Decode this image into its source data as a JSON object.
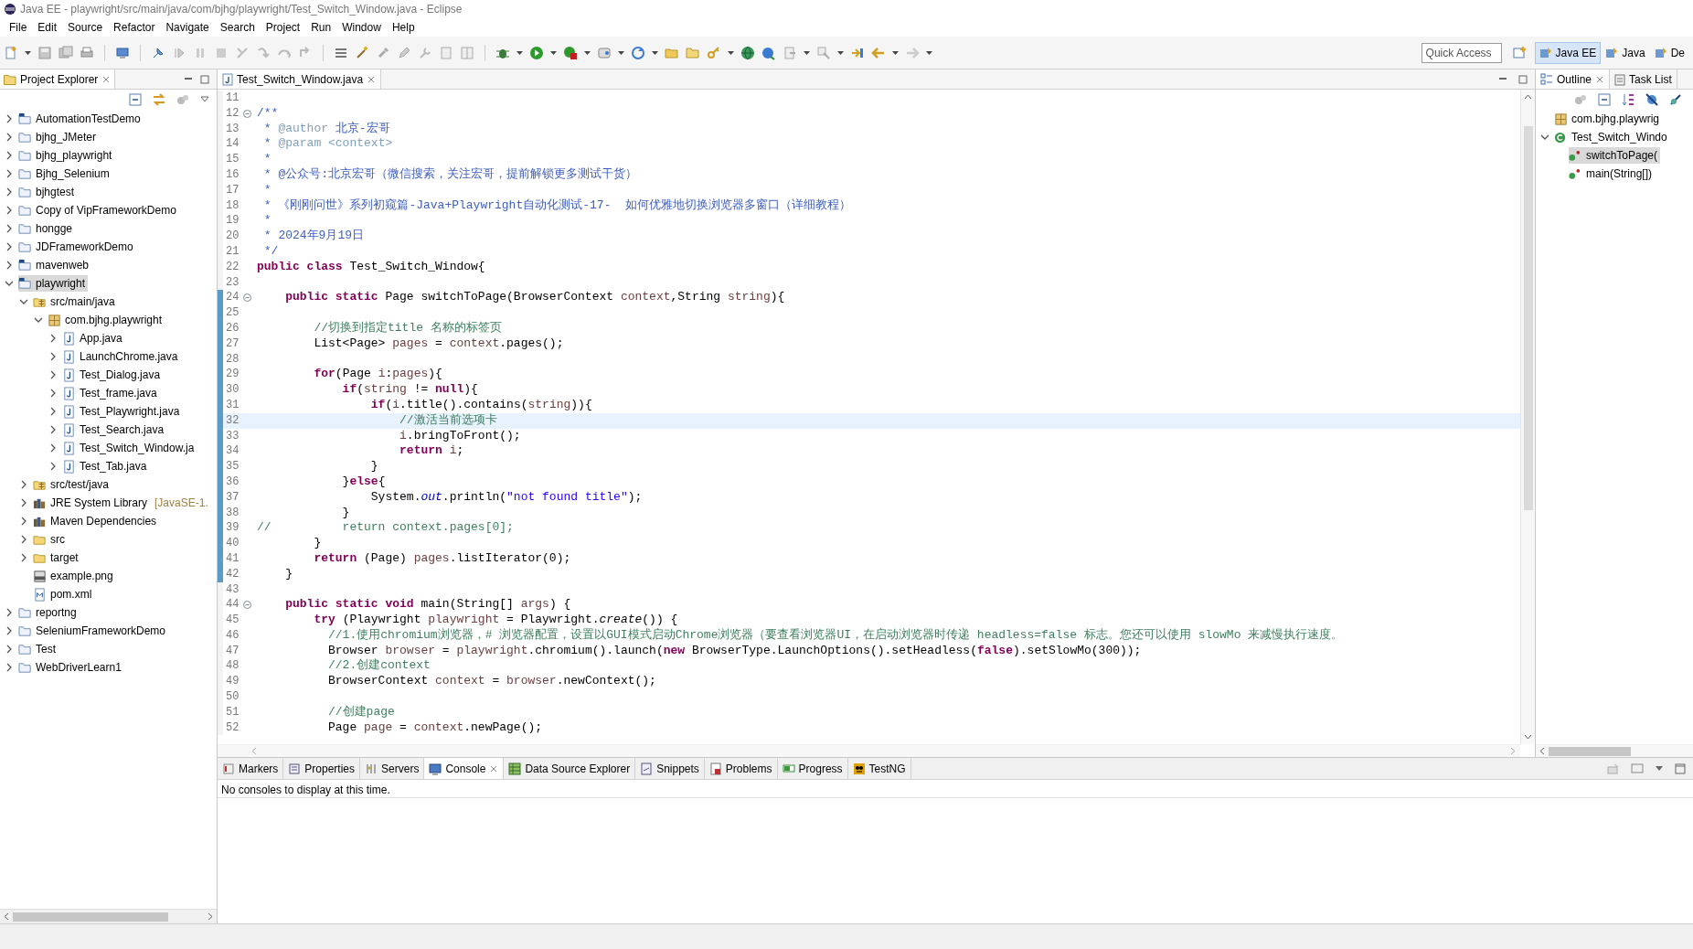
{
  "window": {
    "title": "Java EE - playwright/src/main/java/com/bjhg/playwright/Test_Switch_Window.java - Eclipse"
  },
  "menu": [
    "File",
    "Edit",
    "Source",
    "Refactor",
    "Navigate",
    "Search",
    "Project",
    "Run",
    "Window",
    "Help"
  ],
  "toolbar": {
    "quick_access": {
      "placeholder": "Quick Access"
    },
    "perspectives": [
      {
        "label": "Java EE",
        "selected": true
      },
      {
        "label": "Java",
        "selected": false
      },
      {
        "label": "De",
        "selected": false
      }
    ]
  },
  "project_explorer": {
    "title": "Project Explorer",
    "tree": [
      {
        "label": "AutomationTestDemo",
        "kind": "maven",
        "expanded": false,
        "selected": false
      },
      {
        "label": "bjhg_JMeter",
        "kind": "project",
        "expanded": false,
        "selected": false
      },
      {
        "label": "bjhg_playwright",
        "kind": "project",
        "expanded": false,
        "selected": false
      },
      {
        "label": "Bjhg_Selenium",
        "kind": "project",
        "expanded": false,
        "selected": false
      },
      {
        "label": "bjhgtest",
        "kind": "project",
        "expanded": false,
        "selected": false
      },
      {
        "label": "Copy of VipFrameworkDemo",
        "kind": "project",
        "expanded": false,
        "selected": false
      },
      {
        "label": "hongge",
        "kind": "project",
        "expanded": false,
        "selected": false
      },
      {
        "label": "JDFrameworkDemo",
        "kind": "project",
        "expanded": false,
        "selected": false
      },
      {
        "label": "mavenweb",
        "kind": "maven",
        "expanded": false,
        "selected": false
      },
      {
        "label": "playwright",
        "kind": "maven",
        "expanded": true,
        "selected": true,
        "children": [
          {
            "label": "src/main/java",
            "kind": "source",
            "expanded": true,
            "selected": false,
            "children": [
              {
                "label": "com.bjhg.playwright",
                "kind": "package",
                "expanded": true,
                "selected": false,
                "children": [
                  {
                    "label": "App.java",
                    "kind": "java",
                    "expanded": false,
                    "selected": false
                  },
                  {
                    "label": "LaunchChrome.java",
                    "kind": "java",
                    "expanded": false,
                    "selected": false
                  },
                  {
                    "label": "Test_Dialog.java",
                    "kind": "java",
                    "expanded": false,
                    "selected": false
                  },
                  {
                    "label": "Test_frame.java",
                    "kind": "java",
                    "expanded": false,
                    "selected": false
                  },
                  {
                    "label": "Test_Playwright.java",
                    "kind": "java",
                    "expanded": false,
                    "selected": false
                  },
                  {
                    "label": "Test_Search.java",
                    "kind": "java",
                    "expanded": false,
                    "selected": false
                  },
                  {
                    "label": "Test_Switch_Window.ja",
                    "kind": "java",
                    "expanded": false,
                    "selected": false
                  },
                  {
                    "label": "Test_Tab.java",
                    "kind": "java",
                    "expanded": false,
                    "selected": false
                  }
                ]
              }
            ]
          },
          {
            "label": "src/test/java",
            "kind": "source",
            "expanded": false,
            "selected": false
          },
          {
            "label": "JRE System Library",
            "decoration": "[JavaSE-1.",
            "kind": "library",
            "expanded": false,
            "selected": false
          },
          {
            "label": "Maven Dependencies",
            "kind": "library",
            "expanded": false,
            "selected": false
          },
          {
            "label": "src",
            "kind": "folder",
            "expanded": false,
            "selected": false
          },
          {
            "label": "target",
            "kind": "folder",
            "expanded": false,
            "selected": false
          },
          {
            "label": "example.png",
            "kind": "image",
            "selected": false
          },
          {
            "label": "pom.xml",
            "kind": "xml",
            "selected": false
          }
        ]
      },
      {
        "label": "reportng",
        "kind": "project",
        "expanded": false,
        "selected": false
      },
      {
        "label": "SeleniumFrameworkDemo",
        "kind": "project",
        "expanded": false,
        "selected": false
      },
      {
        "label": "Test",
        "kind": "project",
        "expanded": false,
        "selected": false
      },
      {
        "label": "WebDriverLearn1",
        "kind": "project",
        "expanded": false,
        "selected": false
      }
    ]
  },
  "editor": {
    "tabs": [
      {
        "label": "Test_Switch_Window.java",
        "selected": true
      }
    ],
    "lines": [
      {
        "number": "11",
        "fold": false,
        "changed": false,
        "current": false
      },
      {
        "number": "12",
        "fold": true,
        "changed": false,
        "current": false,
        "tokens": [
          {
            "kind": "doc",
            "text": "/**"
          }
        ]
      },
      {
        "number": "13",
        "fold": false,
        "changed": false,
        "current": false,
        "tokens": [
          {
            "kind": "doc",
            "text": " * "
          },
          {
            "kind": "tag",
            "text": "@author"
          },
          {
            "kind": "doc",
            "text": " 北京-宏哥"
          }
        ]
      },
      {
        "number": "14",
        "fold": false,
        "changed": false,
        "current": false,
        "tokens": [
          {
            "kind": "doc",
            "text": " * "
          },
          {
            "kind": "tag",
            "text": "@param"
          },
          {
            "kind": "tag",
            "text": " <context>"
          }
        ]
      },
      {
        "number": "15",
        "fold": false,
        "changed": false,
        "current": false,
        "tokens": [
          {
            "kind": "doc",
            "text": " *"
          }
        ]
      },
      {
        "number": "16",
        "fold": false,
        "changed": false,
        "current": false,
        "tokens": [
          {
            "kind": "doc",
            "text": " * @公众号:北京宏哥（微信搜索，关注宏哥，提前解锁更多测试干货）"
          }
        ]
      },
      {
        "number": "17",
        "fold": false,
        "changed": false,
        "current": false,
        "tokens": [
          {
            "kind": "doc",
            "text": " *"
          }
        ]
      },
      {
        "number": "18",
        "fold": false,
        "changed": false,
        "current": false,
        "tokens": [
          {
            "kind": "doc",
            "text": " * 《刚刚问世》系列初窥篇-Java+Playwright自动化测试-17-  如何优雅地切换浏览器多窗口（详细教程）"
          }
        ]
      },
      {
        "number": "19",
        "fold": false,
        "changed": false,
        "current": false,
        "tokens": [
          {
            "kind": "doc",
            "text": " *"
          }
        ]
      },
      {
        "number": "20",
        "fold": false,
        "changed": false,
        "current": false,
        "tokens": [
          {
            "kind": "doc",
            "text": " * 2024年9月19日"
          }
        ]
      },
      {
        "number": "21",
        "fold": false,
        "changed": false,
        "current": false,
        "tokens": [
          {
            "kind": "doc",
            "text": " */"
          }
        ]
      },
      {
        "number": "22",
        "fold": false,
        "changed": false,
        "current": false,
        "tokens": [
          {
            "kind": "keyword",
            "text": "public class"
          },
          {
            "kind": "plain",
            "text": " Test_Switch_Window{"
          }
        ]
      },
      {
        "number": "23",
        "fold": false,
        "changed": false,
        "current": false
      },
      {
        "number": "24",
        "fold": true,
        "changed": true,
        "current": false,
        "tokens": [
          {
            "kind": "keyword",
            "text": "    public static"
          },
          {
            "kind": "plain",
            "text": " Page switchToPage(BrowserContext "
          },
          {
            "kind": "variable",
            "text": "context"
          },
          {
            "kind": "plain",
            "text": ",String "
          },
          {
            "kind": "variable",
            "text": "string"
          },
          {
            "kind": "plain",
            "text": "){"
          }
        ]
      },
      {
        "number": "25",
        "fold": false,
        "changed": true,
        "current": false
      },
      {
        "number": "26",
        "fold": false,
        "changed": true,
        "current": false,
        "tokens": [
          {
            "kind": "comment",
            "text": "        //切换到指定title 名称的标签页"
          }
        ]
      },
      {
        "number": "27",
        "fold": false,
        "changed": true,
        "current": false,
        "tokens": [
          {
            "kind": "plain",
            "text": "        List<Page> "
          },
          {
            "kind": "variable",
            "text": "pages"
          },
          {
            "kind": "plain",
            "text": " = "
          },
          {
            "kind": "variable",
            "text": "context"
          },
          {
            "kind": "plain",
            "text": ".pages();"
          }
        ]
      },
      {
        "number": "28",
        "fold": false,
        "changed": true,
        "current": false
      },
      {
        "number": "29",
        "fold": false,
        "changed": true,
        "current": false,
        "tokens": [
          {
            "kind": "keyword",
            "text": "        for"
          },
          {
            "kind": "plain",
            "text": "(Page "
          },
          {
            "kind": "variable",
            "text": "i"
          },
          {
            "kind": "plain",
            "text": ":"
          },
          {
            "kind": "variable",
            "text": "pages"
          },
          {
            "kind": "plain",
            "text": "){"
          }
        ]
      },
      {
        "number": "30",
        "fold": false,
        "changed": true,
        "current": false,
        "tokens": [
          {
            "kind": "keyword",
            "text": "            if"
          },
          {
            "kind": "plain",
            "text": "("
          },
          {
            "kind": "variable",
            "text": "string"
          },
          {
            "kind": "plain",
            "text": " != "
          },
          {
            "kind": "keyword",
            "text": "null"
          },
          {
            "kind": "plain",
            "text": "){"
          }
        ]
      },
      {
        "number": "31",
        "fold": false,
        "changed": true,
        "current": false,
        "tokens": [
          {
            "kind": "keyword",
            "text": "                if"
          },
          {
            "kind": "plain",
            "text": "("
          },
          {
            "kind": "variable",
            "text": "i"
          },
          {
            "kind": "plain",
            "text": ".title().contains("
          },
          {
            "kind": "variable",
            "text": "string"
          },
          {
            "kind": "plain",
            "text": ")){"
          }
        ]
      },
      {
        "number": "32",
        "fold": false,
        "changed": true,
        "current": true,
        "tokens": [
          {
            "kind": "comment",
            "text": "                    //激活当前选项卡"
          }
        ]
      },
      {
        "number": "33",
        "fold": false,
        "changed": true,
        "current": false,
        "tokens": [
          {
            "kind": "variable",
            "text": "                    i"
          },
          {
            "kind": "plain",
            "text": ".bringToFront();"
          }
        ]
      },
      {
        "number": "34",
        "fold": false,
        "changed": true,
        "current": false,
        "tokens": [
          {
            "kind": "keyword",
            "text": "                    return"
          },
          {
            "kind": "variable",
            "text": " i"
          },
          {
            "kind": "plain",
            "text": ";"
          }
        ]
      },
      {
        "number": "35",
        "fold": false,
        "changed": true,
        "current": false,
        "tokens": [
          {
            "kind": "plain",
            "text": "                }"
          }
        ]
      },
      {
        "number": "36",
        "fold": false,
        "changed": true,
        "current": false,
        "tokens": [
          {
            "kind": "plain",
            "text": "            }"
          },
          {
            "kind": "keyword",
            "text": "else"
          },
          {
            "kind": "plain",
            "text": "{"
          }
        ]
      },
      {
        "number": "37",
        "fold": false,
        "changed": true,
        "current": false,
        "tokens": [
          {
            "kind": "plain",
            "text": "                System."
          },
          {
            "kind": "field",
            "text": "out"
          },
          {
            "kind": "plain",
            "text": ".println("
          },
          {
            "kind": "string",
            "text": "\"not found title\""
          },
          {
            "kind": "plain",
            "text": ");"
          }
        ]
      },
      {
        "number": "38",
        "fold": false,
        "changed": true,
        "current": false,
        "tokens": [
          {
            "kind": "plain",
            "text": "            }"
          }
        ]
      },
      {
        "number": "39",
        "fold": false,
        "changed": true,
        "current": false,
        "tokens": [
          {
            "kind": "comment",
            "text": "//          return context.pages[0];"
          }
        ]
      },
      {
        "number": "40",
        "fold": false,
        "changed": true,
        "current": false,
        "tokens": [
          {
            "kind": "plain",
            "text": "        }"
          }
        ]
      },
      {
        "number": "41",
        "fold": false,
        "changed": true,
        "current": false,
        "tokens": [
          {
            "kind": "keyword",
            "text": "        return"
          },
          {
            "kind": "plain",
            "text": " (Page) "
          },
          {
            "kind": "variable",
            "text": "pages"
          },
          {
            "kind": "plain",
            "text": ".listIterator(0);"
          }
        ]
      },
      {
        "number": "42",
        "fold": false,
        "changed": true,
        "current": false,
        "tokens": [
          {
            "kind": "plain",
            "text": "    }"
          }
        ]
      },
      {
        "number": "43",
        "fold": false,
        "changed": false,
        "current": false
      },
      {
        "number": "44",
        "fold": true,
        "changed": false,
        "current": false,
        "tokens": [
          {
            "kind": "keyword",
            "text": "    public static void"
          },
          {
            "kind": "plain",
            "text": " main(String[] "
          },
          {
            "kind": "variable",
            "text": "args"
          },
          {
            "kind": "plain",
            "text": ") {"
          }
        ]
      },
      {
        "number": "45",
        "fold": false,
        "changed": false,
        "current": false,
        "tokens": [
          {
            "kind": "keyword",
            "text": "        try"
          },
          {
            "kind": "plain",
            "text": " (Playwright "
          },
          {
            "kind": "variable",
            "text": "playwright"
          },
          {
            "kind": "plain",
            "text": " = Playwright."
          },
          {
            "kind": "static",
            "text": "create"
          },
          {
            "kind": "plain",
            "text": "()) {"
          }
        ]
      },
      {
        "number": "46",
        "fold": false,
        "changed": false,
        "current": false,
        "tokens": [
          {
            "kind": "comment",
            "text": "          //1.使用chromium浏览器，# 浏览器配置，设置以GUI模式启动Chrome浏览器（要查看浏览器UI，在启动浏览器时传递 headless=false 标志。您还可以使用 slowMo 来减慢执行速度。"
          }
        ]
      },
      {
        "number": "47",
        "fold": false,
        "changed": false,
        "current": false,
        "tokens": [
          {
            "kind": "plain",
            "text": "          Browser "
          },
          {
            "kind": "variable",
            "text": "browser"
          },
          {
            "kind": "plain",
            "text": " = "
          },
          {
            "kind": "variable",
            "text": "playwright"
          },
          {
            "kind": "plain",
            "text": ".chromium().launch("
          },
          {
            "kind": "keyword",
            "text": "new"
          },
          {
            "kind": "plain",
            "text": " BrowserType.LaunchOptions().setHeadless("
          },
          {
            "kind": "keyword",
            "text": "false"
          },
          {
            "kind": "plain",
            "text": ").setSlowMo(300));"
          }
        ]
      },
      {
        "number": "48",
        "fold": false,
        "changed": false,
        "current": false,
        "tokens": [
          {
            "kind": "comment",
            "text": "          //2.创建context"
          }
        ]
      },
      {
        "number": "49",
        "fold": false,
        "changed": false,
        "current": false,
        "tokens": [
          {
            "kind": "plain",
            "text": "          BrowserContext "
          },
          {
            "kind": "variable",
            "text": "context"
          },
          {
            "kind": "plain",
            "text": " = "
          },
          {
            "kind": "variable",
            "text": "browser"
          },
          {
            "kind": "plain",
            "text": ".newContext();"
          }
        ]
      },
      {
        "number": "50",
        "fold": false,
        "changed": false,
        "current": false
      },
      {
        "number": "51",
        "fold": false,
        "changed": false,
        "current": false,
        "tokens": [
          {
            "kind": "comment",
            "text": "          //创建page"
          }
        ]
      },
      {
        "number": "52",
        "fold": false,
        "changed": false,
        "current": false,
        "tokens": [
          {
            "kind": "plain",
            "text": "          Page "
          },
          {
            "kind": "variable",
            "text": "page"
          },
          {
            "kind": "plain",
            "text": " = "
          },
          {
            "kind": "variable",
            "text": "context"
          },
          {
            "kind": "plain",
            "text": ".newPage();"
          }
        ]
      }
    ]
  },
  "outline": {
    "tabs": [
      {
        "label": "Outline",
        "selected": true
      },
      {
        "label": "Task List",
        "selected": false
      }
    ],
    "tree": [
      {
        "label": "com.bjhg.playwrig",
        "kind": "package",
        "selected": false
      },
      {
        "label": "Test_Switch_Windo",
        "kind": "class",
        "expanded": true,
        "selected": false,
        "children": [
          {
            "label": "switchToPage(",
            "kind": "method",
            "selected": true
          },
          {
            "label": "main(String[])",
            "kind": "method",
            "selected": false
          }
        ]
      }
    ]
  },
  "bottom_panel": {
    "tabs": [
      {
        "label": "Markers",
        "selected": false
      },
      {
        "label": "Properties",
        "selected": false
      },
      {
        "label": "Servers",
        "selected": false
      },
      {
        "label": "Console",
        "selected": true
      },
      {
        "label": "Data Source Explorer",
        "selected": false
      },
      {
        "label": "Snippets",
        "selected": false
      },
      {
        "label": "Problems",
        "selected": false
      },
      {
        "label": "Progress",
        "selected": false
      },
      {
        "label": "TestNG",
        "selected": false
      }
    ],
    "message": "No consoles to display at this time."
  }
}
